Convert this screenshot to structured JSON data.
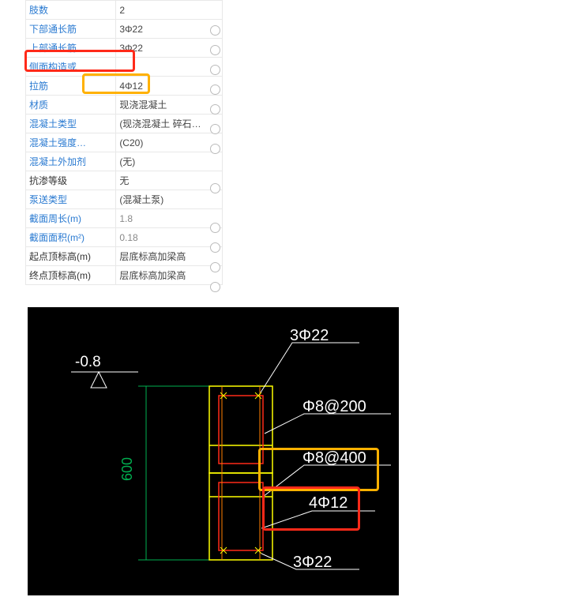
{
  "rows": [
    {
      "label": "肢数",
      "value": "2",
      "blue": true,
      "gray": false,
      "radio": false
    },
    {
      "label": "下部通长筋",
      "value": "3Φ22",
      "blue": true,
      "gray": false,
      "radio": true
    },
    {
      "label": "上部通长筋",
      "value": "3Φ22",
      "blue": true,
      "gray": false,
      "radio": true
    },
    {
      "label": "侧面构造或",
      "value": "",
      "blue": true,
      "gray": false,
      "radio": true
    },
    {
      "label": "拉筋",
      "value": "4Φ12",
      "blue": true,
      "gray": false,
      "radio": true
    },
    {
      "label": "材质",
      "value": "现浇混凝土",
      "blue": true,
      "gray": false,
      "radio": true
    },
    {
      "label": "混凝土类型",
      "value": "(现浇混凝土   碎石…",
      "blue": true,
      "gray": false,
      "radio": true
    },
    {
      "label": "混凝土强度…",
      "value": "(C20)",
      "blue": true,
      "gray": false,
      "radio": true
    },
    {
      "label": "混凝土外加剂",
      "value": "(无)",
      "blue": true,
      "gray": false,
      "radio": false
    },
    {
      "label": "抗渗等级",
      "value": "无",
      "blue": false,
      "gray": false,
      "radio": true
    },
    {
      "label": "泵送类型",
      "value": "(混凝土泵)",
      "blue": true,
      "gray": false,
      "radio": false
    },
    {
      "label": "截面周长(m)",
      "value": "1.8",
      "blue": true,
      "gray": true,
      "radio": true
    },
    {
      "label": "截面面积(m²)",
      "value": "0.18",
      "blue": true,
      "gray": true,
      "radio": true
    },
    {
      "label": "起点顶标高(m)",
      "value": "层底标高加梁高",
      "blue": false,
      "gray": false,
      "radio": true
    },
    {
      "label": "终点顶标高(m)",
      "value": "层底标高加梁高",
      "blue": false,
      "gray": false,
      "radio": true
    }
  ],
  "cad": {
    "level": "-0.8",
    "dim_v": "600",
    "bar_top": "3Φ22",
    "bar_bot": "3Φ22",
    "stirrup1": "Φ8@200",
    "stirrup2": "Φ8@400",
    "tie": "4Φ12"
  },
  "colors": {
    "red": "#ff2a19",
    "orange": "#ffb100"
  }
}
